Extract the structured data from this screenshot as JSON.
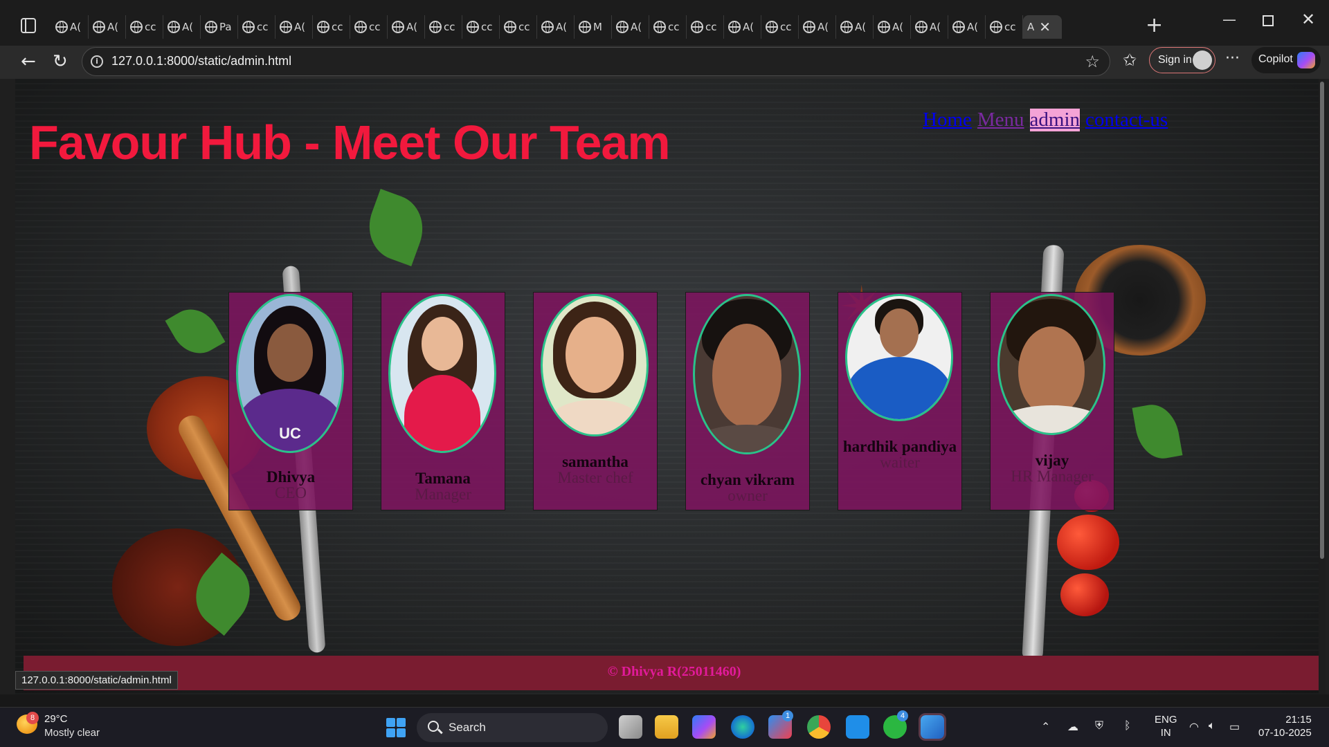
{
  "browser": {
    "tabs": [
      {
        "label": "A(",
        "icon": "globe-icon"
      },
      {
        "label": "A(",
        "icon": "globe-icon"
      },
      {
        "label": "cc",
        "icon": "globe-icon"
      },
      {
        "label": "A(",
        "icon": "globe-icon"
      },
      {
        "label": "Pa",
        "icon": "globe-icon"
      },
      {
        "label": "cc",
        "icon": "globe-icon"
      },
      {
        "label": "A(",
        "icon": "globe-icon"
      },
      {
        "label": "cc",
        "icon": "globe-icon"
      },
      {
        "label": "cc",
        "icon": "globe-icon"
      },
      {
        "label": "A(",
        "icon": "globe-icon"
      },
      {
        "label": "cc",
        "icon": "globe-icon"
      },
      {
        "label": "cc",
        "icon": "globe-icon"
      },
      {
        "label": "cc",
        "icon": "globe-icon"
      },
      {
        "label": "A(",
        "icon": "globe-icon"
      },
      {
        "label": "M",
        "icon": "globe-icon"
      },
      {
        "label": "A(",
        "icon": "globe-icon"
      },
      {
        "label": "cc",
        "icon": "globe-icon"
      },
      {
        "label": "cc",
        "icon": "globe-icon"
      },
      {
        "label": "A(",
        "icon": "globe-icon"
      },
      {
        "label": "cc",
        "icon": "globe-icon"
      },
      {
        "label": "A(",
        "icon": "globe-icon"
      },
      {
        "label": "A(",
        "icon": "globe-icon"
      },
      {
        "label": "A(",
        "icon": "globe-icon"
      },
      {
        "label": "A(",
        "icon": "globe-icon"
      },
      {
        "label": "A(",
        "icon": "globe-icon"
      },
      {
        "label": "cc",
        "icon": "globe-icon"
      },
      {
        "label": "A",
        "icon": "globe-icon",
        "active": true
      }
    ],
    "url": "127.0.0.1:8000/static/admin.html",
    "sign_in": "Sign in",
    "copilot": "Copilot",
    "status_link": "127.0.0.1:8000/static/admin.html"
  },
  "site": {
    "nav": {
      "home": "Home",
      "menu": "Menu",
      "admin": "admin",
      "contact": "contact-us"
    },
    "title": "Favour Hub - Meet Our Team",
    "team": [
      {
        "name": "Dhivya",
        "role": "CEO"
      },
      {
        "name": "Tamana",
        "role": "Manager"
      },
      {
        "name": "samantha",
        "role": "Master chef"
      },
      {
        "name": "chyan vikram",
        "role": "owner"
      },
      {
        "name": "hardhik pandiya",
        "role": "waiter"
      },
      {
        "name": "vijay",
        "role": "HR Manager"
      }
    ],
    "footer": "© Dhivya R(25011460)"
  },
  "taskbar": {
    "weather_temp": "29°C",
    "weather_desc": "Mostly clear",
    "weather_badge": "8",
    "search": "Search",
    "store_badge": "1",
    "whatsapp_badge": "4",
    "lang_top": "ENG",
    "lang_bottom": "IN",
    "time": "21:15",
    "date": "07-10-2025"
  },
  "colors": {
    "title": "#f2193d",
    "card_bg": "#7d145f",
    "photo_border": "#2ac28a",
    "footer_bg": "#7a1c30",
    "footer_text": "#e21a9a"
  }
}
